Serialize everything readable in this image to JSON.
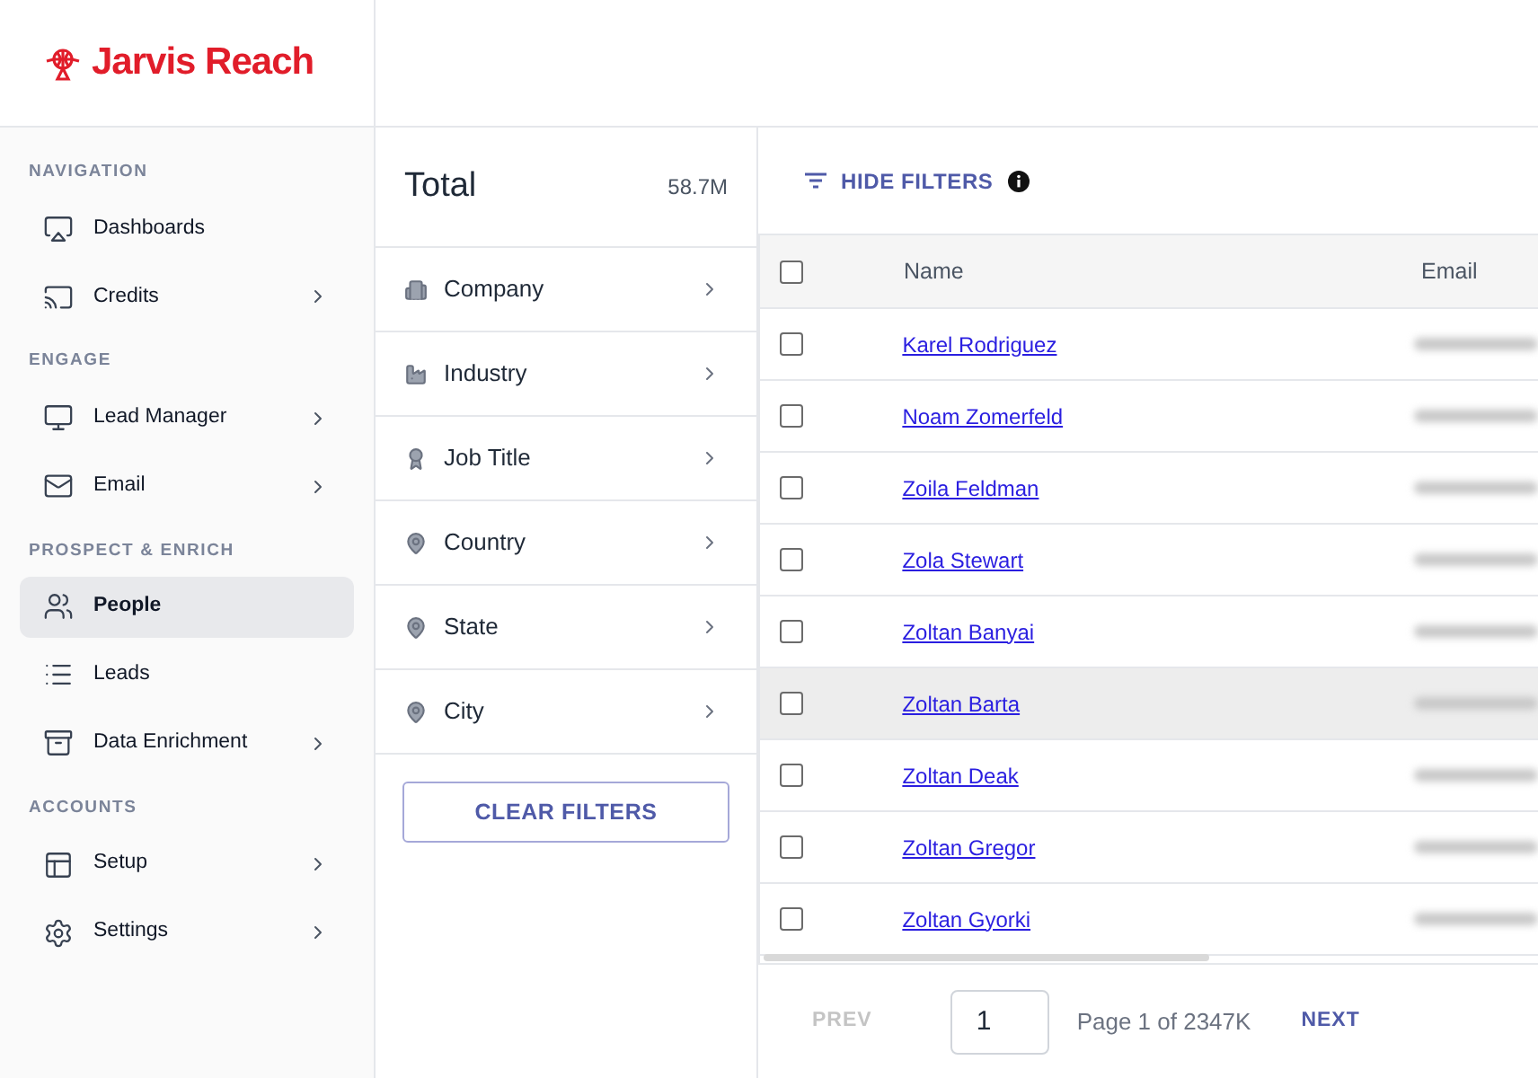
{
  "logo": {
    "text": "Jarvis Reach"
  },
  "sidebar": {
    "sections": [
      {
        "title": "NAVIGATION",
        "items": [
          {
            "label": "Dashboards",
            "has_submenu": false,
            "selected": false
          },
          {
            "label": "Credits",
            "has_submenu": true,
            "selected": false
          }
        ]
      },
      {
        "title": "ENGAGE",
        "items": [
          {
            "label": "Lead Manager",
            "has_submenu": true,
            "selected": false
          },
          {
            "label": "Email",
            "has_submenu": true,
            "selected": false
          }
        ]
      },
      {
        "title": "PROSPECT & ENRICH",
        "items": [
          {
            "label": "People",
            "has_submenu": false,
            "selected": true
          },
          {
            "label": "Leads",
            "has_submenu": false,
            "selected": false
          },
          {
            "label": "Data Enrichment",
            "has_submenu": true,
            "selected": false
          }
        ]
      },
      {
        "title": "ACCOUNTS",
        "items": [
          {
            "label": "Setup",
            "has_submenu": true,
            "selected": false
          },
          {
            "label": "Settings",
            "has_submenu": true,
            "selected": false
          }
        ]
      }
    ]
  },
  "filters": {
    "total_label": "Total",
    "total_value": "58.7M",
    "items": [
      {
        "label": "Company"
      },
      {
        "label": "Industry"
      },
      {
        "label": "Job Title"
      },
      {
        "label": "Country"
      },
      {
        "label": "State"
      },
      {
        "label": "City"
      }
    ],
    "clear_button": "CLEAR FILTERS"
  },
  "toolbar": {
    "hide_filters": "HIDE FILTERS"
  },
  "table": {
    "columns": [
      "Name",
      "Email"
    ],
    "all_checked": false,
    "rows": [
      {
        "name": "Karel Rodriguez",
        "checked": false,
        "hovered": false
      },
      {
        "name": "Noam Zomerfeld",
        "checked": false,
        "hovered": false
      },
      {
        "name": "Zoila Feldman",
        "checked": false,
        "hovered": false
      },
      {
        "name": "Zola Stewart",
        "checked": false,
        "hovered": false
      },
      {
        "name": "Zoltan Banyai",
        "checked": false,
        "hovered": false
      },
      {
        "name": "Zoltan Barta",
        "checked": false,
        "hovered": true
      },
      {
        "name": "Zoltan Deak",
        "checked": false,
        "hovered": false
      },
      {
        "name": "Zoltan Gregor",
        "checked": false,
        "hovered": false
      },
      {
        "name": "Zoltan Gyorki",
        "checked": false,
        "hovered": false
      }
    ]
  },
  "pagination": {
    "prev": "PREV",
    "prev_disabled": true,
    "page_input": "1",
    "page_text": "Page 1 of 2347K",
    "next": "NEXT"
  }
}
